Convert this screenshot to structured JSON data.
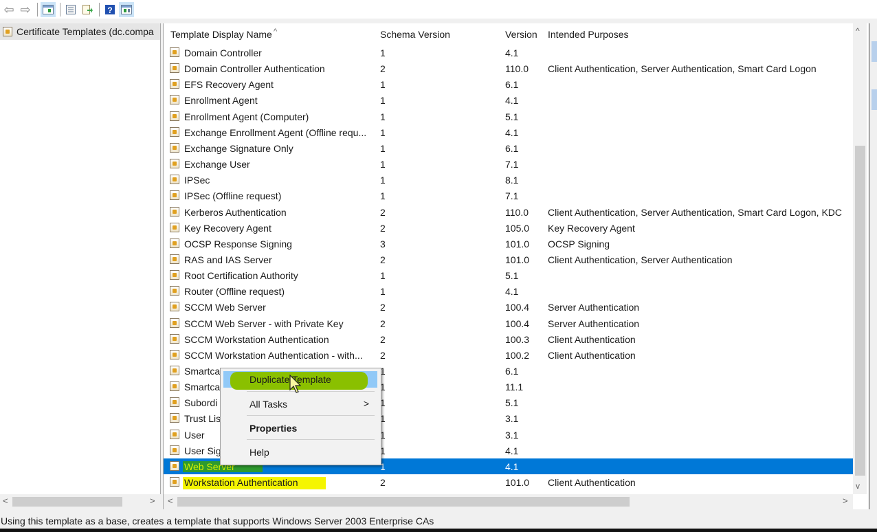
{
  "toolbar": {
    "buttons": [
      "back-arrow",
      "forward-arrow",
      "show-hide-console-tree",
      "properties",
      "export-list",
      "help",
      "show-hide-action-pane"
    ]
  },
  "tree": {
    "item_label": "Certificate Templates (dc.compa"
  },
  "columns": {
    "name": "Template Display Name",
    "schema": "Schema Version",
    "version": "Version",
    "purposes": "Intended Purposes"
  },
  "rows": [
    {
      "name": "Domain Controller",
      "schema": "1",
      "version": "4.1",
      "purposes": ""
    },
    {
      "name": "Domain Controller Authentication",
      "schema": "2",
      "version": "110.0",
      "purposes": "Client Authentication, Server Authentication, Smart Card Logon"
    },
    {
      "name": "EFS Recovery Agent",
      "schema": "1",
      "version": "6.1",
      "purposes": ""
    },
    {
      "name": "Enrollment Agent",
      "schema": "1",
      "version": "4.1",
      "purposes": ""
    },
    {
      "name": "Enrollment Agent (Computer)",
      "schema": "1",
      "version": "5.1",
      "purposes": ""
    },
    {
      "name": "Exchange Enrollment Agent (Offline requ...",
      "schema": "1",
      "version": "4.1",
      "purposes": ""
    },
    {
      "name": "Exchange Signature Only",
      "schema": "1",
      "version": "6.1",
      "purposes": ""
    },
    {
      "name": "Exchange User",
      "schema": "1",
      "version": "7.1",
      "purposes": ""
    },
    {
      "name": "IPSec",
      "schema": "1",
      "version": "8.1",
      "purposes": ""
    },
    {
      "name": "IPSec (Offline request)",
      "schema": "1",
      "version": "7.1",
      "purposes": ""
    },
    {
      "name": "Kerberos Authentication",
      "schema": "2",
      "version": "110.0",
      "purposes": "Client Authentication, Server Authentication, Smart Card Logon, KDC"
    },
    {
      "name": "Key Recovery Agent",
      "schema": "2",
      "version": "105.0",
      "purposes": "Key Recovery Agent"
    },
    {
      "name": "OCSP Response Signing",
      "schema": "3",
      "version": "101.0",
      "purposes": "OCSP Signing"
    },
    {
      "name": "RAS and IAS Server",
      "schema": "2",
      "version": "101.0",
      "purposes": "Client Authentication, Server Authentication"
    },
    {
      "name": "Root Certification Authority",
      "schema": "1",
      "version": "5.1",
      "purposes": ""
    },
    {
      "name": "Router (Offline request)",
      "schema": "1",
      "version": "4.1",
      "purposes": ""
    },
    {
      "name": "SCCM Web Server",
      "schema": "2",
      "version": "100.4",
      "purposes": "Server Authentication"
    },
    {
      "name": "SCCM Web Server - with Private Key",
      "schema": "2",
      "version": "100.4",
      "purposes": "Server Authentication"
    },
    {
      "name": "SCCM Workstation Authentication",
      "schema": "2",
      "version": "100.3",
      "purposes": "Client Authentication"
    },
    {
      "name": "SCCM Workstation Authentication - with...",
      "schema": "2",
      "version": "100.2",
      "purposes": "Client Authentication"
    },
    {
      "name": "Smartca",
      "schema": "1",
      "version": "6.1",
      "purposes": ""
    },
    {
      "name": "Smartca",
      "schema": "1",
      "version": "11.1",
      "purposes": ""
    },
    {
      "name": "Subordi",
      "schema": "1",
      "version": "5.1",
      "purposes": ""
    },
    {
      "name": "Trust Lis",
      "schema": "1",
      "version": "3.1",
      "purposes": ""
    },
    {
      "name": "User",
      "schema": "1",
      "version": "3.1",
      "purposes": ""
    },
    {
      "name": "User Sig",
      "schema": "1",
      "version": "4.1",
      "purposes": ""
    },
    {
      "name": "Web Server",
      "schema": "1",
      "version": "4.1",
      "purposes": "",
      "selected": true
    },
    {
      "name": "Workstation Authentication",
      "schema": "2",
      "version": "101.0",
      "purposes": "Client Authentication",
      "highlighted": true
    }
  ],
  "context_menu": {
    "items": [
      "Duplicate Template",
      "All Tasks",
      "Properties",
      "Help"
    ],
    "hovered": "Duplicate Template",
    "submenu_arrow": ">"
  },
  "scroll": {
    "left_prev": "<",
    "left_next": ">",
    "up": "^",
    "down": "v"
  },
  "status_bar": "Using this template as a base, creates a template that supports Windows Server 2003 Enterprise CAs",
  "colors": {
    "selection": "#0078d7",
    "menu_hover": "#91c9f7",
    "highlight_yellow": "#f5f500",
    "highlight_green": "#2e9a2e"
  }
}
